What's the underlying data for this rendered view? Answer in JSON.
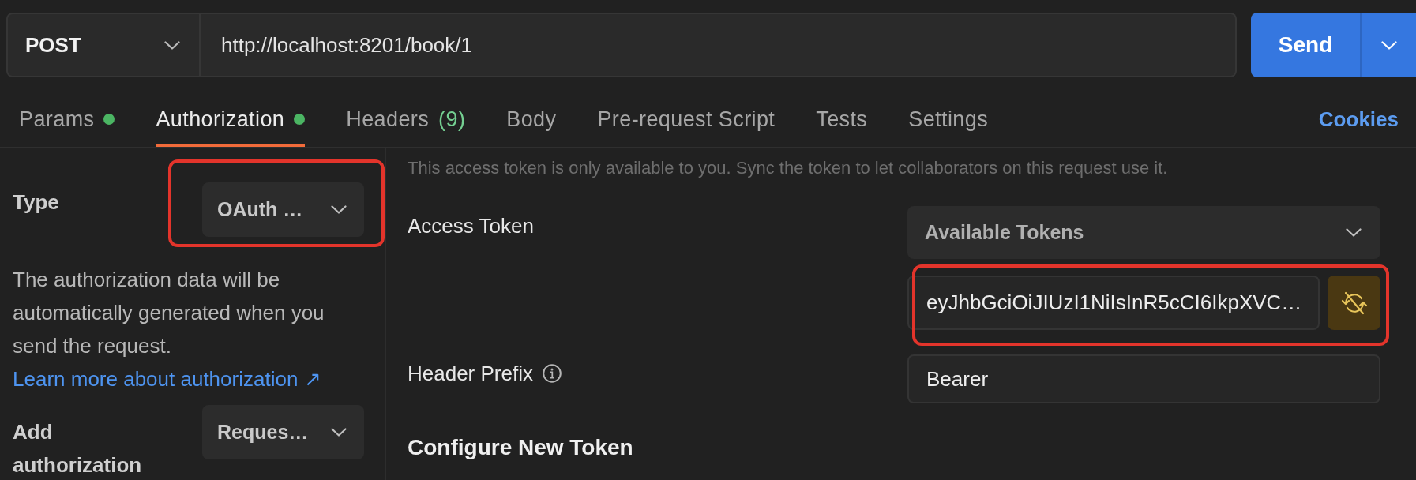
{
  "request_bar": {
    "method": "POST",
    "url": "http://localhost:8201/book/1",
    "send_label": "Send"
  },
  "tabs": [
    {
      "label": "Params",
      "dot": true,
      "selected": false
    },
    {
      "label": "Authorization",
      "dot": true,
      "selected": true
    },
    {
      "label": "Headers",
      "count": "(9)",
      "dot": false,
      "selected": false
    },
    {
      "label": "Body",
      "dot": false,
      "selected": false
    },
    {
      "label": "Pre-request Script",
      "dot": false,
      "selected": false
    },
    {
      "label": "Tests",
      "dot": false,
      "selected": false
    },
    {
      "label": "Settings",
      "dot": false,
      "selected": false
    }
  ],
  "cookies_link": "Cookies",
  "auth_sidebar": {
    "type": {
      "label": "Type",
      "value": "OAuth …",
      "highlighted": true
    },
    "description": "The authorization data will be automatically generated when you send the request.",
    "learn_more_link": "Learn more about authorization ↗",
    "add_to": {
      "label": "Add authorization",
      "value": "Reques…"
    }
  },
  "token_panel": {
    "notice": "This access token is only available to you. Sync the token to let collaborators on this request use it.",
    "access_token": {
      "label": "Access Token",
      "dropdown": "Available Tokens",
      "value": "eyJhbGciOiJIUzI1NiIsInR5cCI6IkpXVC…",
      "highlighted": true
    },
    "header_prefix": {
      "label": "Header Prefix",
      "value": "Bearer"
    },
    "section_title": "Configure New Token"
  }
}
